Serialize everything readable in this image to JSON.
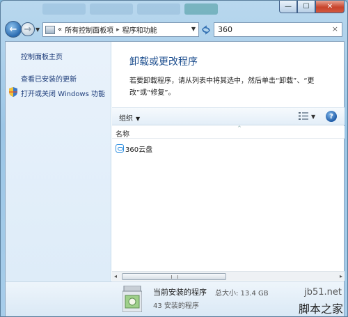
{
  "titlebar": {
    "minimize_glyph": "—",
    "maximize_glyph": "☐",
    "close_glyph": "✕"
  },
  "navbar": {
    "back_glyph": "←",
    "forward_glyph": "→",
    "address": {
      "prefix": "«",
      "items": [
        "所有控制面板项",
        "程序和功能"
      ],
      "separator": "▸"
    },
    "search_value": "360",
    "search_clear": "×"
  },
  "sidebar": {
    "links": [
      "控制面板主页",
      "查看已安装的更新",
      "打开或关闭 Windows 功能"
    ]
  },
  "main": {
    "title": "卸载或更改程序",
    "description": "若要卸载程序，请从列表中将其选中，然后单击“卸载”、“更改”或“修复”。"
  },
  "toolbar": {
    "organize_label": "组织",
    "dropdown_glyph": "▼",
    "help_glyph": "?"
  },
  "list": {
    "column_name": "名称",
    "sort_glyph": "^",
    "rows": [
      {
        "name": "360云盘",
        "icon": "cloud-disk-icon"
      }
    ]
  },
  "details": {
    "title": "当前安装的程序",
    "total_size_label": "总大小: 13.4 GB",
    "count_label": "43 安装的程序"
  },
  "watermark": {
    "url": "jb51.net",
    "name": "脚本之家"
  },
  "colors": {
    "accent": "#1e4f8f",
    "link": "#1e3d7a",
    "close_button": "#c7432b"
  }
}
